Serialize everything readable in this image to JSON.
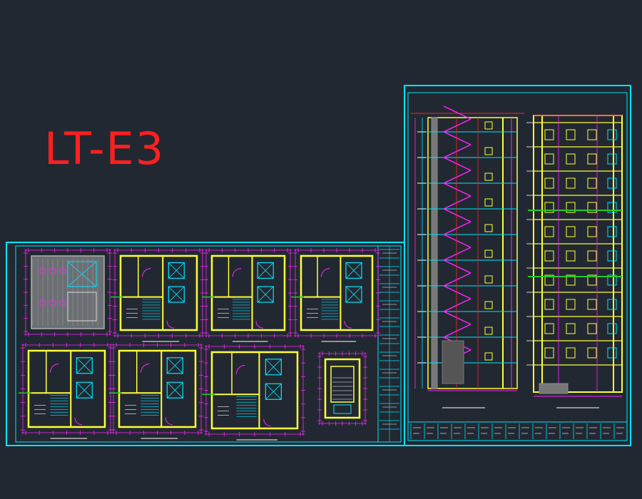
{
  "drawing": {
    "label": "LT-E3"
  },
  "colors": {
    "background": "#222831",
    "frame": "#00e5ff",
    "wall": "#ffff3a",
    "dimension": "#ff22ff",
    "axis": "#ff2222",
    "text": "#ffffff",
    "hatch": "#b0b0b0",
    "grid": "#22cc22"
  },
  "sheets": [
    {
      "name": "plans-sheet",
      "plans": 8
    },
    {
      "name": "section-elevation-sheet",
      "views": 2
    }
  ]
}
